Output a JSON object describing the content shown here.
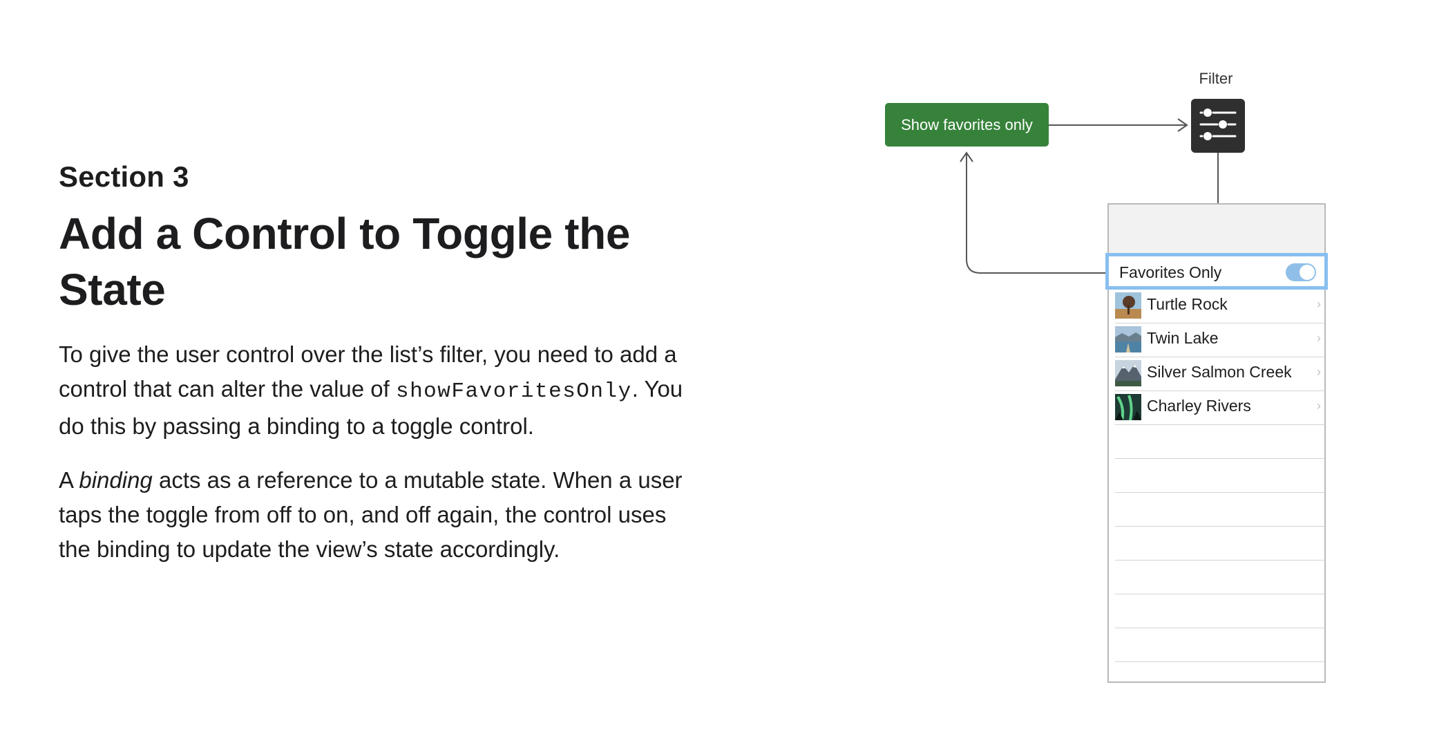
{
  "section": "Section 3",
  "title": "Add a Control to Toggle the State",
  "paragraph1": {
    "part1": "To give the user control over the list’s filter, you need to add a control that can alter the value of ",
    "code": "showFavoritesOnly",
    "part2": ". You do this by passing a binding to a toggle control."
  },
  "paragraph2": {
    "part1": "A ",
    "emphasis": "binding",
    "part2": " acts as a reference to a mutable state. When a user taps the toggle from off to on, and off again, the control uses the binding to update the view’s state accordingly."
  },
  "diagram": {
    "button_label": "Show favorites only",
    "filter_label": "Filter",
    "filter_icon": "sliders-icon",
    "toggle_label": "Favorites Only",
    "toggle_on": true,
    "landmarks": [
      {
        "name": "Turtle Rock"
      },
      {
        "name": "Twin Lake"
      },
      {
        "name": "Silver Salmon Creek"
      },
      {
        "name": "Charley Rivers"
      }
    ],
    "empty_rows": 8
  },
  "colors": {
    "button_green": "#37823b",
    "filter_dark": "#2f2f2f",
    "highlight_blue": "#88bff0",
    "toggle_blue": "#8fbfe8"
  }
}
